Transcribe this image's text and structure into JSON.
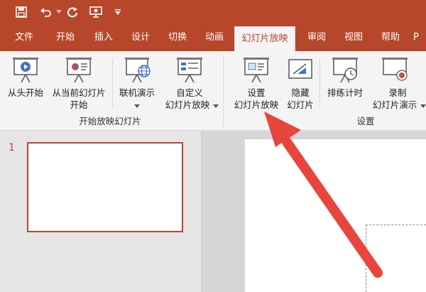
{
  "quick_access": {
    "icons": [
      "save-icon",
      "undo-icon",
      "redo-icon",
      "present-icon",
      "customize-icon"
    ]
  },
  "tabs": [
    {
      "label": "文件",
      "active": false
    },
    {
      "label": "开始",
      "active": false
    },
    {
      "label": "插入",
      "active": false
    },
    {
      "label": "设计",
      "active": false
    },
    {
      "label": "切换",
      "active": false
    },
    {
      "label": "动画",
      "active": false
    },
    {
      "label": "幻灯片放映",
      "active": true
    },
    {
      "label": "审阅",
      "active": false
    },
    {
      "label": "视图",
      "active": false
    },
    {
      "label": "帮助",
      "active": false
    },
    {
      "label": "P",
      "active": false
    }
  ],
  "ribbon": {
    "start_group": {
      "label": "开始放映幻灯片",
      "from_beginning": "从头开始",
      "from_current_1": "从当前幻灯片",
      "from_current_2": "开始",
      "online_present": "联机演示",
      "custom_show_1": "自定义",
      "custom_show_2": "幻灯片放映"
    },
    "setup_group": {
      "label": "设置",
      "setup_show_1": "设置",
      "setup_show_2": "幻灯片放映",
      "hide_slide_1": "隐藏",
      "hide_slide_2": "幻灯片",
      "rehearse": "排练计时",
      "record_1": "录制",
      "record_2": "幻灯片演示"
    }
  },
  "slides_pane": {
    "slide_number": "1"
  },
  "colors": {
    "accent": "#b7472a",
    "arrow": "#e8453c"
  }
}
